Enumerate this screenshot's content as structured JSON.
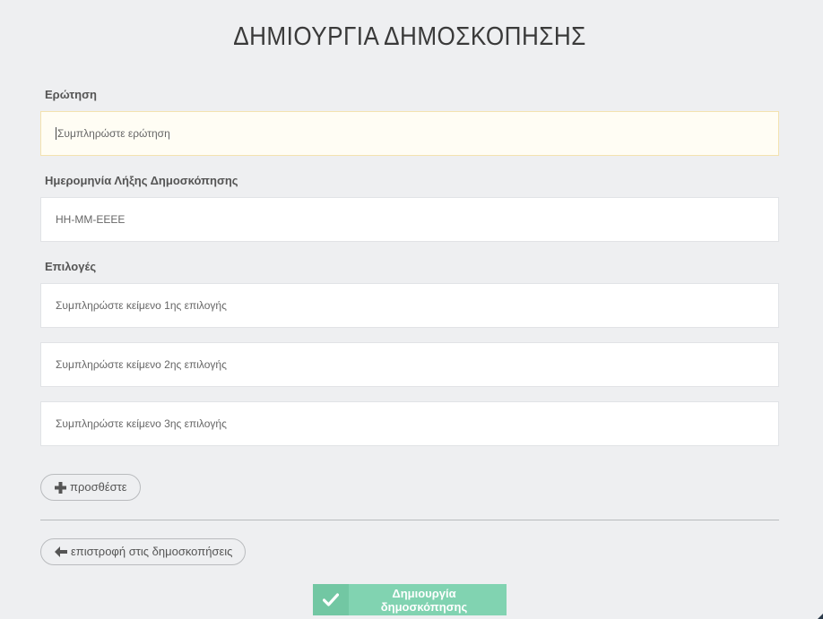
{
  "page": {
    "title": "ΔΗΜΙΟΥΡΓΙΑ ΔΗΜΟΣΚΟΠΗΣΗΣ"
  },
  "question": {
    "label": "Ερώτηση",
    "placeholder": "Συμπληρώστε ερώτηση",
    "value": ""
  },
  "end_date": {
    "label": "Ημερομηνία Λήξης Δημοσκόπησης",
    "placeholder": "ΗΗ-ΜΜ-ΕΕΕΕ",
    "value": ""
  },
  "options": {
    "label": "Επιλογές",
    "items": [
      {
        "placeholder": "Συμπληρώστε κείμενο 1ης επιλογής"
      },
      {
        "placeholder": "Συμπληρώστε κείμενο 2ης επιλογής"
      },
      {
        "placeholder": "Συμπληρώστε κείμενο 3ης επιλογής"
      }
    ]
  },
  "buttons": {
    "add_label": "προσθέστε",
    "add_icon": "plus-icon",
    "back_label": "επιστροφή στις δημοσκοπήσεις",
    "back_icon": "arrow-left-icon",
    "create_label": "Δημιουργία δημοσκόπησης",
    "create_icon": "check-icon"
  },
  "colors": {
    "background": "#eeeff1",
    "create_button": "#81d3b1",
    "create_button_icon_bg": "#72c7a3",
    "focused_field_border": "#f3e2b0"
  }
}
